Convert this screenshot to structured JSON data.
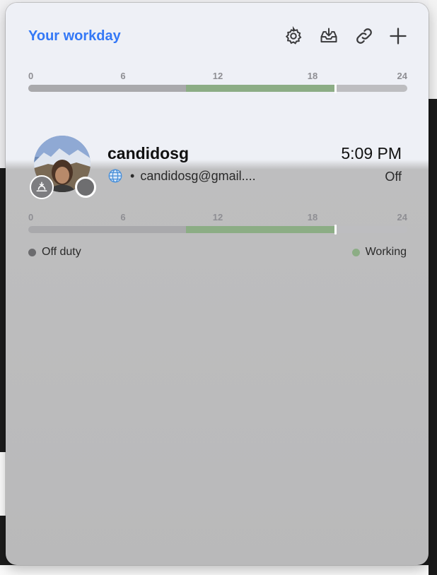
{
  "header": {
    "title": "Your workday",
    "tools": [
      "settings-icon",
      "download-tray-icon",
      "link-icon",
      "plus-icon"
    ]
  },
  "schedule": {
    "ticks": [
      "0",
      "6",
      "12",
      "18",
      "24"
    ],
    "workday_hours": [
      10,
      19.5
    ],
    "current_hour": 19.4
  },
  "person": {
    "name": "candidosg",
    "email": "candidosg@gmail....",
    "separator": "•",
    "time": "5:09 PM",
    "status": "Off",
    "schedule": {
      "ticks": [
        "0",
        "6",
        "12",
        "18",
        "24"
      ],
      "workday_hours": [
        10,
        19.5
      ],
      "current_hour": 19.4
    }
  },
  "legend": {
    "off_label": "Off duty",
    "working_label": "Working"
  },
  "colors": {
    "accent": "#3478f6",
    "working": "#8cad85",
    "off": "#6b6b6e"
  }
}
